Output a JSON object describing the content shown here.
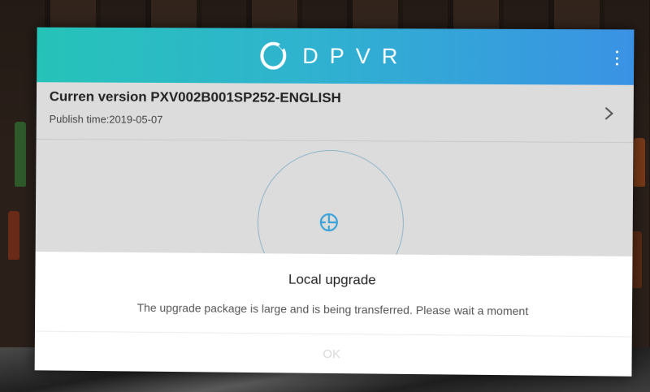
{
  "header": {
    "brand": "DPVR",
    "logo_icon": "dpvr-ring-logo-icon",
    "menu_icon": "more-vertical-icon",
    "gradient": [
      "#26c3b8",
      "#3a92e4"
    ]
  },
  "version": {
    "title": "Curren version PXV002B001SP252-ENGLISH",
    "publish_time": "Publish time:2019-05-07",
    "chevron_icon": "chevron-right-icon"
  },
  "progress": {
    "ring_icon": "progress-ring",
    "center_icon": "crosshair-target-icon",
    "accent": "#3aa3d8"
  },
  "dialog": {
    "title": "Local upgrade",
    "message": "The upgrade package is large and is being transferred. Please wait a moment",
    "ok_label": "OK"
  }
}
